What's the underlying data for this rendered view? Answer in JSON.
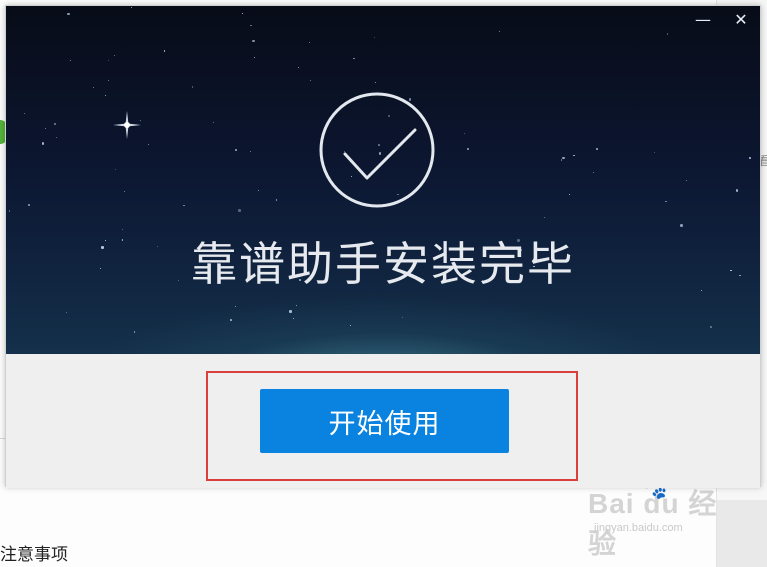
{
  "dialog": {
    "title_text": "靠谱助手安装完毕",
    "start_button_label": "开始使用",
    "window_controls": {
      "minimize_symbol": "—",
      "close_symbol": "✕"
    },
    "icons": {
      "success": "check-circle-icon",
      "sparkle": "sparkle-icon"
    },
    "colors": {
      "button": "#0a83e0",
      "highlight_frame": "#d9403b",
      "hero_background": "#0c1630"
    }
  },
  "background_page": {
    "footer_text": "注意事项",
    "right_edge_char": "看"
  },
  "watermark": {
    "brand_text": "Bai du 经验",
    "url_text": "jingyan.baidu.com"
  }
}
